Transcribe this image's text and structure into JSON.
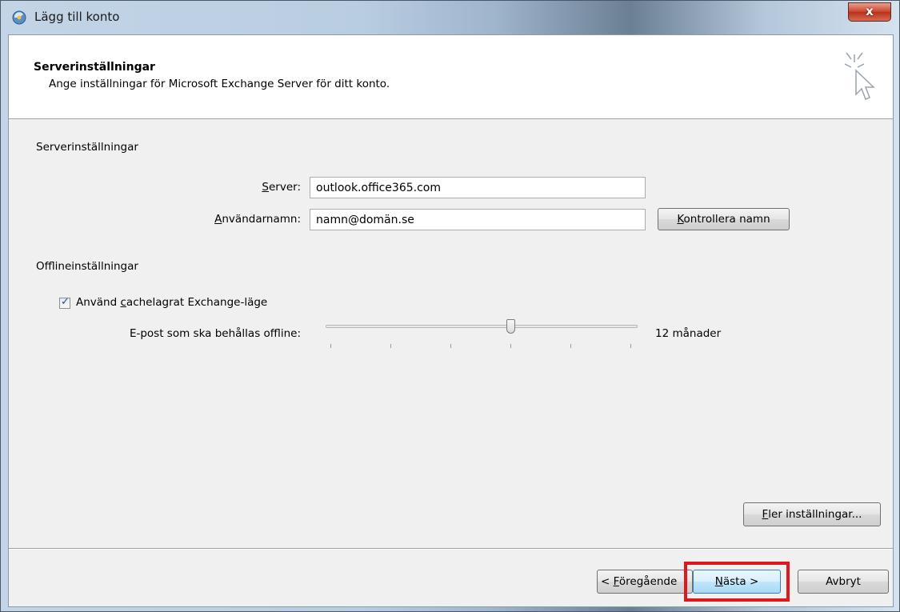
{
  "window": {
    "title": "Lägg till konto",
    "close_label": "x"
  },
  "header": {
    "title": "Serverinställningar",
    "subtitle": "Ange inställningar för Microsoft Exchange Server för ditt konto."
  },
  "server_section": {
    "label": "Serverinställningar",
    "server_label_hotkey": "S",
    "server_label_rest": "erver:",
    "server_value": "outlook.office365.com",
    "username_label_hotkey": "A",
    "username_label_rest": "nvändarnamn:",
    "username_value": "namn@domän.se",
    "check_name_hotkey": "K",
    "check_name_rest": "ontrollera namn"
  },
  "offline_section": {
    "label": "Offlineinställningar",
    "cached_mode_prefix": "Använd ",
    "cached_mode_hotkey": "c",
    "cached_mode_rest": "achelagrat Exchange-läge",
    "cached_mode_checked": true,
    "offline_mail_label": "E-post som ska behållas offline:",
    "offline_mail_value": "12 månader",
    "slider_position_fraction": 0.6
  },
  "buttons": {
    "more_settings_hotkey": "F",
    "more_settings_rest": "ler inställningar...",
    "back_prefix": "< ",
    "back_hotkey": "F",
    "back_rest": "öregående",
    "next_hotkey": "N",
    "next_rest": "ästa >",
    "cancel_label": "Avbryt"
  },
  "colors": {
    "highlight": "#e0181e"
  }
}
